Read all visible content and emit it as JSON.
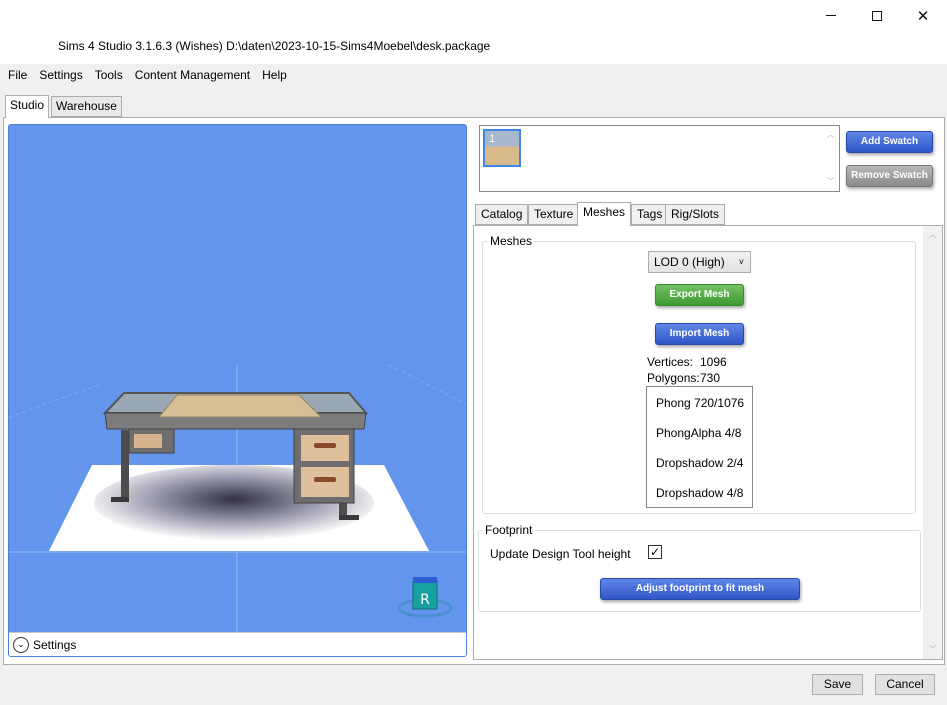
{
  "window": {
    "title": "Sims 4 Studio 3.1.6.3 (Wishes)  D:\\daten\\2023-10-15-Sims4Moebel\\desk.package",
    "close_glyph": "✕"
  },
  "menu": [
    "File",
    "Settings",
    "Tools",
    "Content Management",
    "Help"
  ],
  "top_tabs": {
    "studio": "Studio",
    "warehouse": "Warehouse"
  },
  "viewport": {
    "settings_label": "Settings",
    "settings_glyph": "⌄",
    "gizmo_letter": "R"
  },
  "swatches": {
    "items": [
      {
        "label": "1",
        "selected": true
      }
    ],
    "add_label": "Add Swatch",
    "remove_label": "Remove Swatch",
    "scroll_up": "︿",
    "scroll_down": "﹀"
  },
  "right_tabs": [
    "Catalog",
    "Texture",
    "Meshes",
    "Tags",
    "Rig/Slots"
  ],
  "active_right_tab": "Meshes",
  "meshes": {
    "group_label": "Meshes",
    "lod_selected": "LOD 0 (High)",
    "lod_chevron": "˅",
    "export_label": "Export Mesh",
    "import_label": "Import Mesh",
    "vertices_label": "Vertices:",
    "vertices_value": "1096",
    "polygons_label": "Polygons:",
    "polygons_value": "730",
    "shaders": [
      "Phong 720/1076",
      "PhongAlpha 4/8",
      "Dropshadow 2/4",
      "Dropshadow 4/8"
    ]
  },
  "footprint": {
    "group_label": "Footprint",
    "checkbox_label": "Update Design Tool height",
    "checkbox_checked": true,
    "checkbox_glyph": "✓",
    "adjust_label": "Adjust footprint to fit mesh"
  },
  "footer": {
    "save_label": "Save",
    "cancel_label": "Cancel"
  },
  "colors": {
    "viewport_bg": "#6495ed",
    "accent_blue": "#2f56c8",
    "export_green": "#3f9a31",
    "selection_border": "#3e86e8"
  }
}
